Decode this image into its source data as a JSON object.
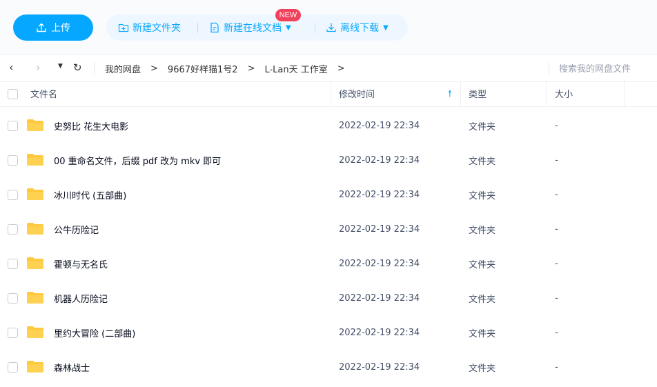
{
  "toolbar": {
    "upload_label": "上传",
    "new_folder_label": "新建文件夹",
    "new_online_doc_label": "新建在线文档",
    "new_badge": "NEW",
    "offline_download_label": "离线下载"
  },
  "path": {
    "crumbs": [
      "我的网盘",
      "9667好样猫1号2",
      "L-Lan天 工作室"
    ],
    "separator": ">",
    "search_placeholder": "搜索我的网盘文件"
  },
  "table": {
    "headers": {
      "name": "文件名",
      "modified": "修改时间",
      "type": "类型",
      "size": "大小"
    },
    "rows": [
      {
        "name": "史努比 花生大电影",
        "modified": "2022-02-19 22:34",
        "type": "文件夹",
        "size": "-"
      },
      {
        "name": "00 重命名文件，后缀 pdf 改为 mkv 即可",
        "modified": "2022-02-19 22:34",
        "type": "文件夹",
        "size": "-"
      },
      {
        "name": "冰川时代 (五部曲)",
        "modified": "2022-02-19 22:34",
        "type": "文件夹",
        "size": "-"
      },
      {
        "name": "公牛历险记",
        "modified": "2022-02-19 22:34",
        "type": "文件夹",
        "size": "-"
      },
      {
        "name": "霍顿与无名氏",
        "modified": "2022-02-19 22:34",
        "type": "文件夹",
        "size": "-"
      },
      {
        "name": "机器人历险记",
        "modified": "2022-02-19 22:34",
        "type": "文件夹",
        "size": "-"
      },
      {
        "name": "里约大冒险 (二部曲)",
        "modified": "2022-02-19 22:34",
        "type": "文件夹",
        "size": "-"
      },
      {
        "name": "森林战士",
        "modified": "2022-02-19 22:34",
        "type": "文件夹",
        "size": "-"
      }
    ]
  },
  "colors": {
    "accent": "#06a7ff",
    "badge": "#f2425b",
    "folder": "#ffc83d"
  }
}
